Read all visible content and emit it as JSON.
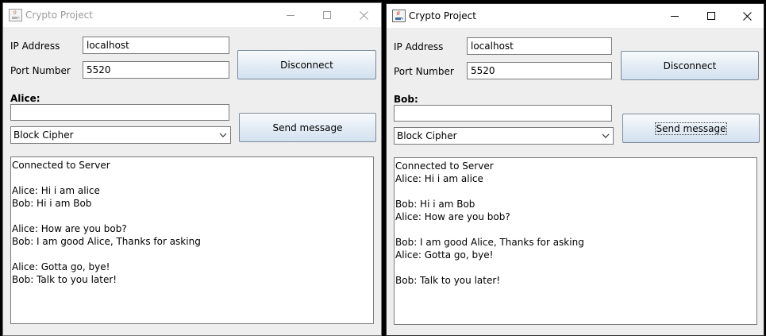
{
  "left_window": {
    "title": "Crypto Project",
    "ip_label": "IP Address",
    "ip_value": "localhost",
    "port_label": "Port Number",
    "port_value": "5520",
    "connect_button": "Disconnect",
    "user_label": "Alice:",
    "message_value": "",
    "cipher_selected": "Block Cipher",
    "send_button": "Send message",
    "chat_lines": [
      "Connected to Server",
      "",
      "Alice: Hi i am alice",
      "Bob: Hi i am Bob",
      "",
      "Alice: How are you bob?",
      "Bob: I am good Alice, Thanks for asking",
      "",
      "Alice: Gotta go, bye!",
      "Bob: Talk to you later!"
    ]
  },
  "right_window": {
    "title": "Crypto Project",
    "ip_label": "IP Address",
    "ip_value": "localhost",
    "port_label": "Port Number",
    "port_value": "5520",
    "connect_button": "Disconnect",
    "user_label": "Bob:",
    "message_value": "",
    "cipher_selected": "Block Cipher",
    "send_button": "Send message",
    "chat_lines": [
      "Connected to Server",
      "Alice: Hi i am alice",
      "",
      "Bob: Hi i am Bob",
      "Alice: How are you bob?",
      "",
      "Bob: I am good Alice, Thanks for asking",
      "Alice: Gotta go, bye!",
      "",
      "Bob: Talk to you later!"
    ]
  },
  "icons": {
    "app": "java-cup-icon",
    "minimize": "minimize-icon",
    "maximize": "maximize-icon",
    "close": "close-icon",
    "dropdown": "chevron-down-icon"
  },
  "colors": {
    "window_bg": "#eeeeee",
    "desktop_bg": "#000000",
    "inactive_title": "#9a9a9a",
    "button_gradient_top": "#f9fbfd",
    "button_gradient_bottom": "#d3e1ef"
  }
}
